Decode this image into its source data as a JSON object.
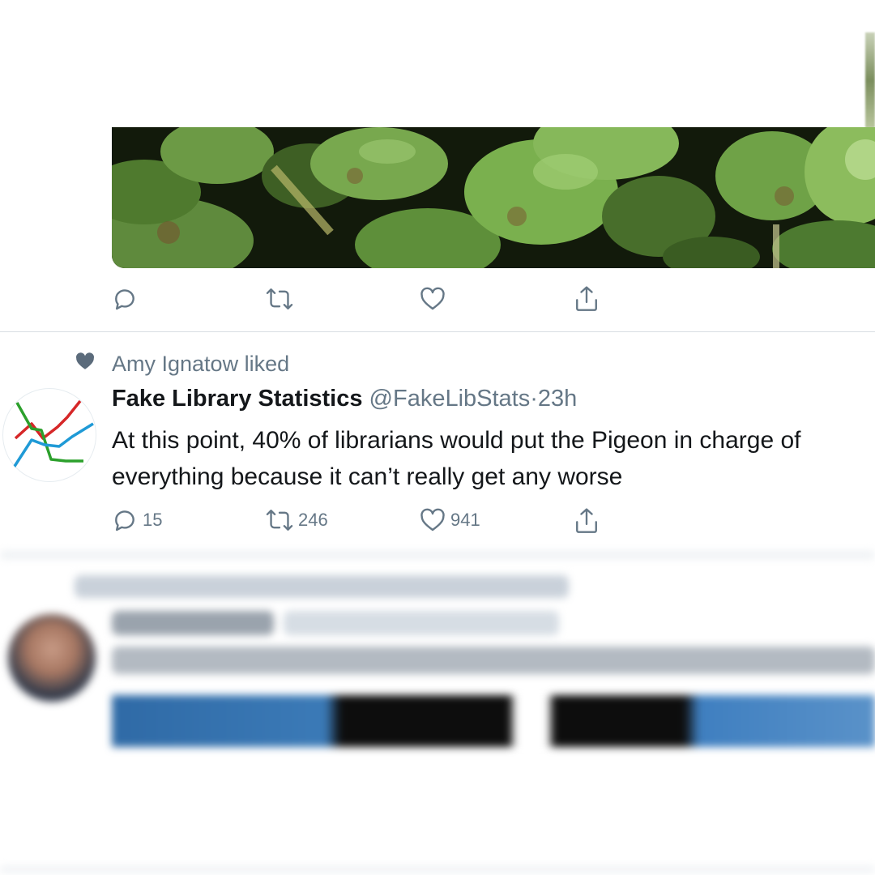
{
  "previous_tweet": {
    "actions": [
      {
        "icon": "reply-icon",
        "count": ""
      },
      {
        "icon": "retweet-icon",
        "count": ""
      },
      {
        "icon": "like-icon",
        "count": ""
      },
      {
        "icon": "share-icon",
        "count": ""
      }
    ]
  },
  "liked_tweet": {
    "social_context": "Amy Ignatow liked",
    "social_context_icon": "heart-icon",
    "display_name": "Fake Library Statistics",
    "handle": "@FakeLibStats",
    "separator": "·",
    "time": "23h",
    "body": "At this point, 40% of librarians would put the Pigeon in charge of everything because it can’t really get any worse",
    "actions": {
      "reply_count": "15",
      "retweet_count": "246",
      "like_count": "941"
    },
    "avatar_colors": [
      "#d62728",
      "#2ca02c",
      "#1f9ad6"
    ]
  },
  "colors": {
    "secondary_text": "#657786",
    "primary_text": "#14171a",
    "divider": "#d8dee3"
  }
}
